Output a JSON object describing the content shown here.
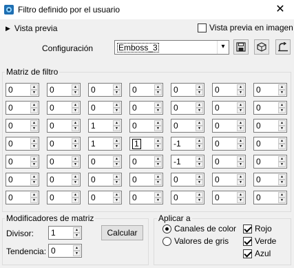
{
  "window": {
    "title": "Filtro definido por el usuario",
    "close_glyph": "✕",
    "icon": "psp-filter-icon"
  },
  "preview": {
    "toggle_label": "Vista previa",
    "image_preview_label": "Vista previa en imagen",
    "image_preview_checked": false
  },
  "config": {
    "label": "Configuración",
    "value": "Emboss_3",
    "buttons": [
      "save-preset-icon",
      "reset-preset-icon",
      "restore-preset-icon"
    ]
  },
  "matrix": {
    "title": "Matriz de filtro",
    "rows": [
      [
        "0",
        "0",
        "0",
        "0",
        "0",
        "0",
        "0"
      ],
      [
        "0",
        "0",
        "0",
        "0",
        "0",
        "0",
        "0"
      ],
      [
        "0",
        "0",
        "1",
        "0",
        "0",
        "0",
        "0"
      ],
      [
        "0",
        "0",
        "1",
        "1",
        "-1",
        "0",
        "0"
      ],
      [
        "0",
        "0",
        "0",
        "0",
        "-1",
        "0",
        "0"
      ],
      [
        "0",
        "0",
        "0",
        "0",
        "0",
        "0",
        "0"
      ],
      [
        "0",
        "0",
        "0",
        "0",
        "0",
        "0",
        "0"
      ]
    ],
    "focused_cell": [
      3,
      3
    ]
  },
  "modifiers": {
    "title": "Modificadores de matriz",
    "divisor_label": "Divisor:",
    "divisor_value": "1",
    "calc_label": "Calcular",
    "tendencia_label": "Tendencia:",
    "tendencia_value": "0"
  },
  "apply": {
    "title": "Aplicar a",
    "modes": [
      {
        "label": "Canales de color",
        "selected": true
      },
      {
        "label": "Valores de gris",
        "selected": false
      }
    ],
    "channels": [
      {
        "label": "Rojo",
        "checked": true
      },
      {
        "label": "Verde",
        "checked": true
      },
      {
        "label": "Azul",
        "checked": true
      }
    ]
  }
}
